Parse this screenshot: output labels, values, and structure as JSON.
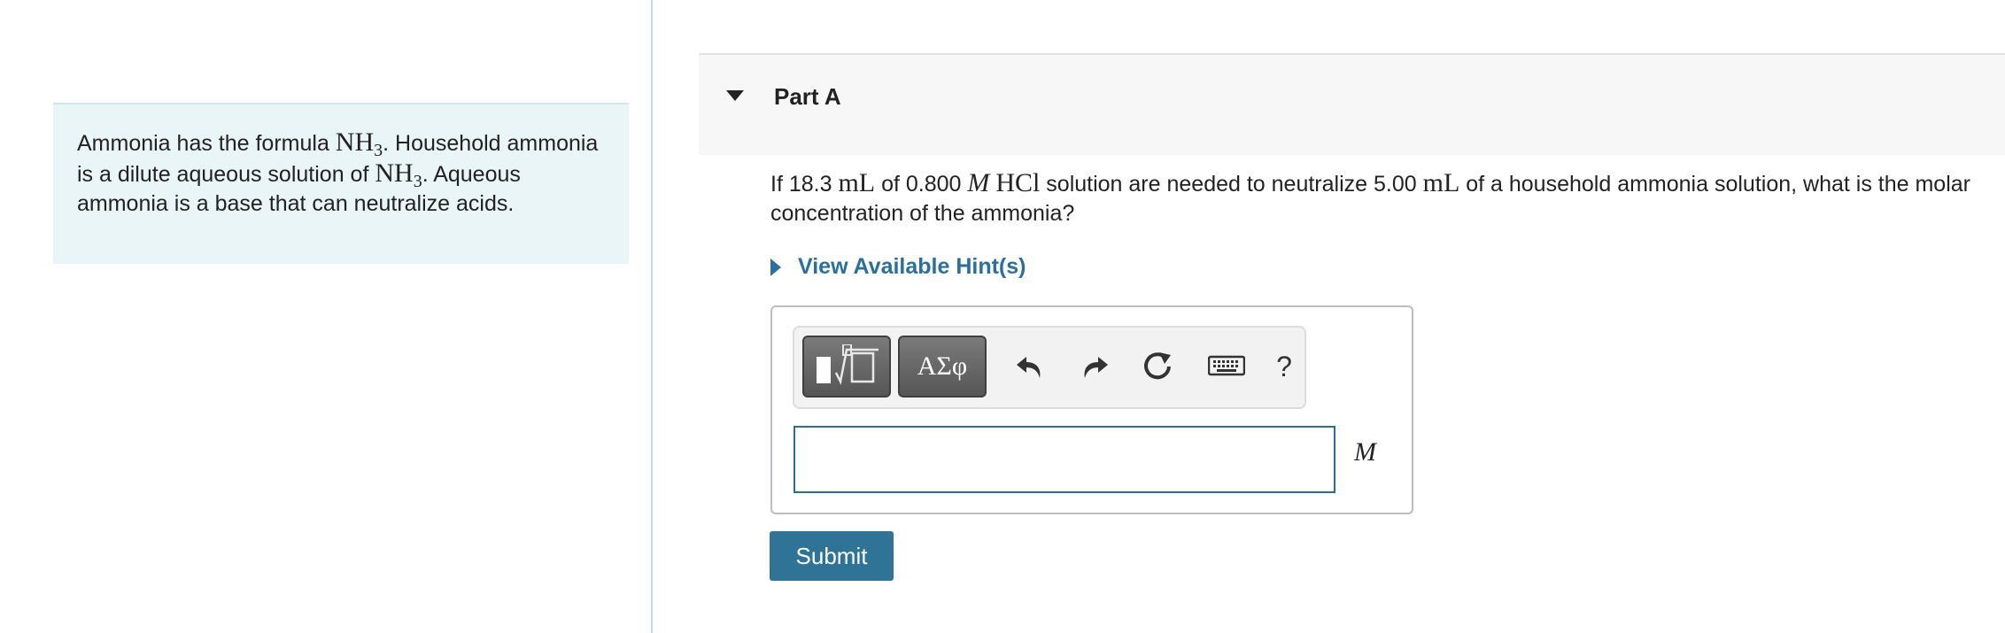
{
  "intro": {
    "text_1": "Ammonia has the formula ",
    "formula_base": "NH",
    "formula_sub": "3",
    "text_2": ". Household ammonia is a dilute aqueous solution of ",
    "text_3": ". Aqueous ammonia is a base that can neutralize acids."
  },
  "part": {
    "title": "Part A",
    "expanded": true
  },
  "question": {
    "t1": "If 18.3 ",
    "unit_ml": "mL",
    "t2": " of 0.800 ",
    "molar": "M",
    "hcl": "HCl",
    "t3": " solution are needed to neutralize 5.00 ",
    "t4": " of a household ammonia solution, what is the molar concentration of the ammonia?"
  },
  "hint": {
    "label": "View Available Hint(s)"
  },
  "toolbar": {
    "templates_icon": "templates-icon",
    "symbols_label": "ΑΣφ",
    "undo_icon": "undo-icon",
    "redo_icon": "redo-icon",
    "reset_icon": "reset-icon",
    "keyboard_icon": "keyboard-icon",
    "help_label": "?"
  },
  "answer": {
    "value": "",
    "placeholder": "",
    "unit": "M"
  },
  "submit": {
    "label": "Submit"
  },
  "colors": {
    "accent": "#2f7497",
    "link": "#2b6f9e",
    "intro_bg": "#e9f5f6",
    "input_border": "#2c6e91"
  }
}
